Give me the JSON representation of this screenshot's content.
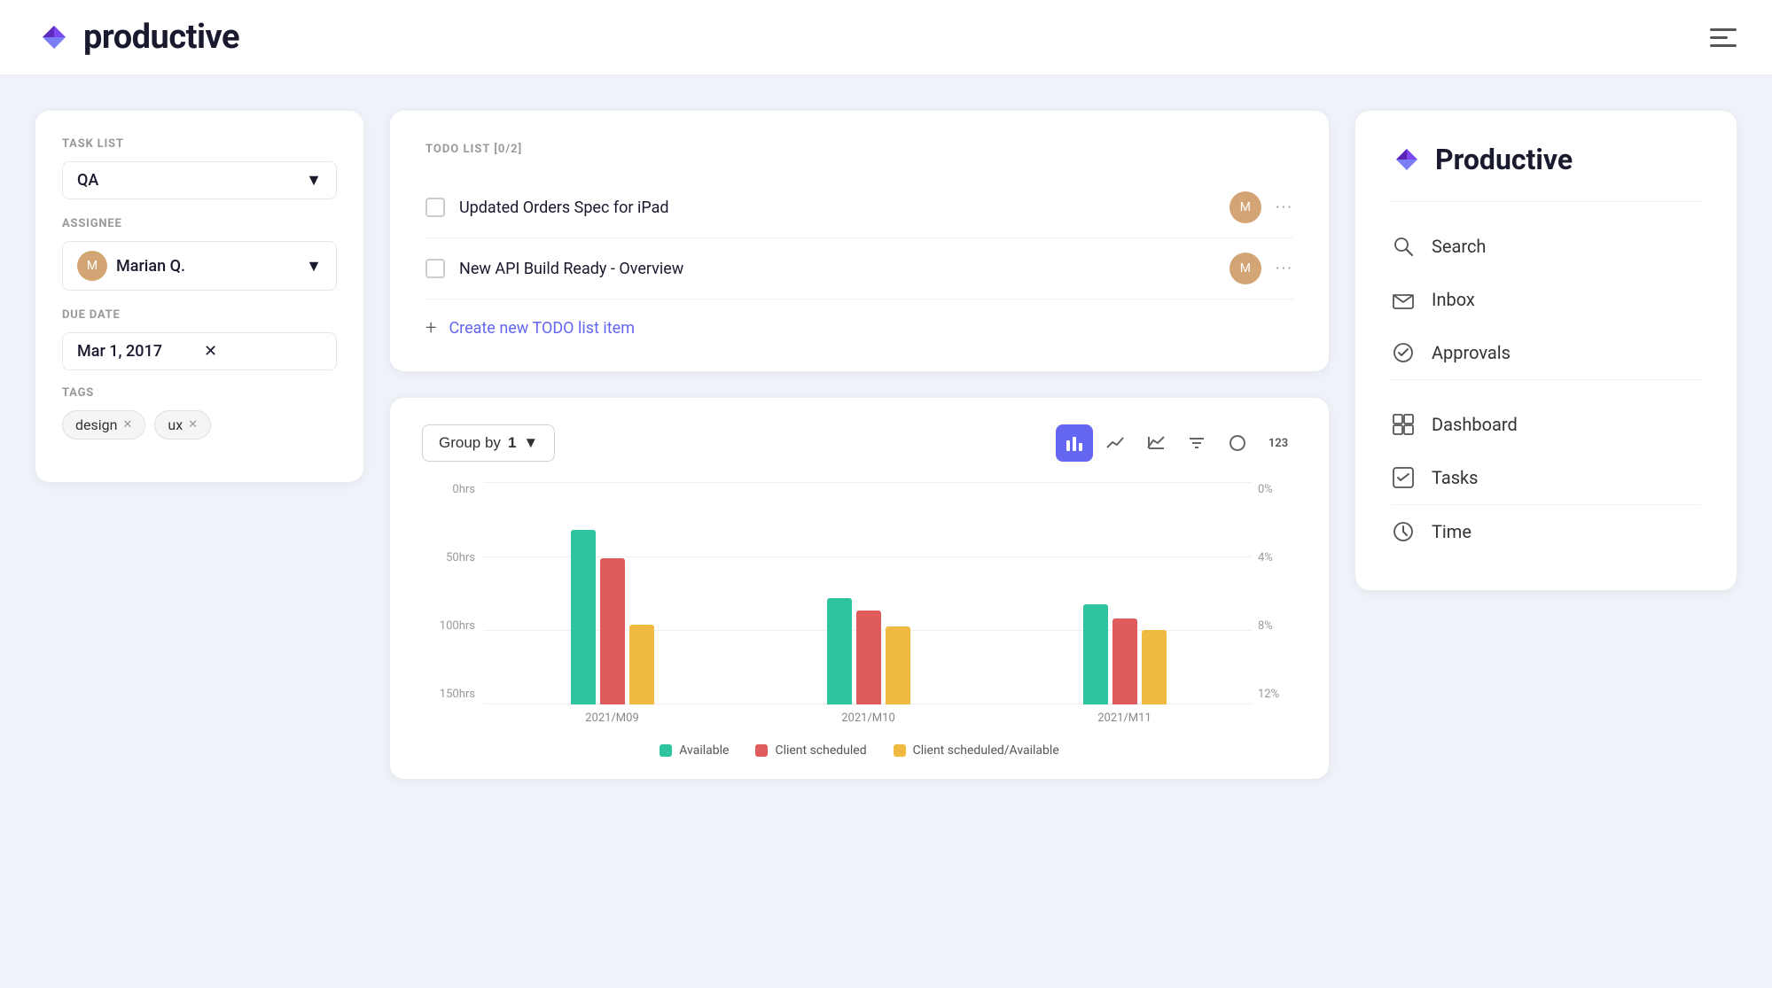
{
  "app": {
    "name": "productive",
    "logo_alt": "Productive logo"
  },
  "top_nav": {
    "logo_text": "productive"
  },
  "todo": {
    "title": "TODO LIST [0/2]",
    "items": [
      {
        "text": "Updated Orders Spec for iPad",
        "checked": false
      },
      {
        "text": "New API Build Ready - Overview",
        "checked": false
      }
    ],
    "create_label": "Create new TODO list item"
  },
  "task_filter": {
    "task_list_label": "TASK LIST",
    "task_list_value": "QA",
    "assignee_label": "ASSIGNEE",
    "assignee_name": "Marian Q.",
    "due_date_label": "DUE DATE",
    "due_date_value": "Mar 1, 2017",
    "tags_label": "TAGS",
    "tags": [
      "design",
      "ux"
    ]
  },
  "chart": {
    "group_by_label": "Group by",
    "group_by_num": "1",
    "months": [
      {
        "label": "2021/M09",
        "available_hrs": 130,
        "client_scheduled_hrs": 110,
        "client_available_hrs": 60
      },
      {
        "label": "2021/M10",
        "available_hrs": 80,
        "client_scheduled_hrs": 70,
        "client_available_hrs": 58
      },
      {
        "label": "2021/M11",
        "available_hrs": 75,
        "client_scheduled_hrs": 65,
        "client_available_hrs": 55
      }
    ],
    "y_labels_left": [
      "0hrs",
      "50hrs",
      "100hrs",
      "150hrs"
    ],
    "y_labels_right": [
      "0%",
      "4%",
      "8%",
      "12%"
    ],
    "legend": [
      {
        "label": "Available",
        "color": "#2ec4a0"
      },
      {
        "label": "Client scheduled",
        "color": "#e05c5c"
      },
      {
        "label": "Client scheduled/Available",
        "color": "#f0b940"
      }
    ],
    "chart_icons": [
      "bar-chart",
      "line-chart",
      "area-chart",
      "filter",
      "circle",
      "number"
    ]
  },
  "sidebar": {
    "title": "Productive",
    "items": [
      {
        "label": "Search",
        "icon": "search-icon"
      },
      {
        "label": "Inbox",
        "icon": "inbox-icon"
      },
      {
        "label": "Approvals",
        "icon": "approvals-icon"
      },
      {
        "label": "Dashboard",
        "icon": "dashboard-icon"
      },
      {
        "label": "Tasks",
        "icon": "tasks-icon"
      },
      {
        "label": "Time",
        "icon": "time-icon"
      }
    ]
  }
}
